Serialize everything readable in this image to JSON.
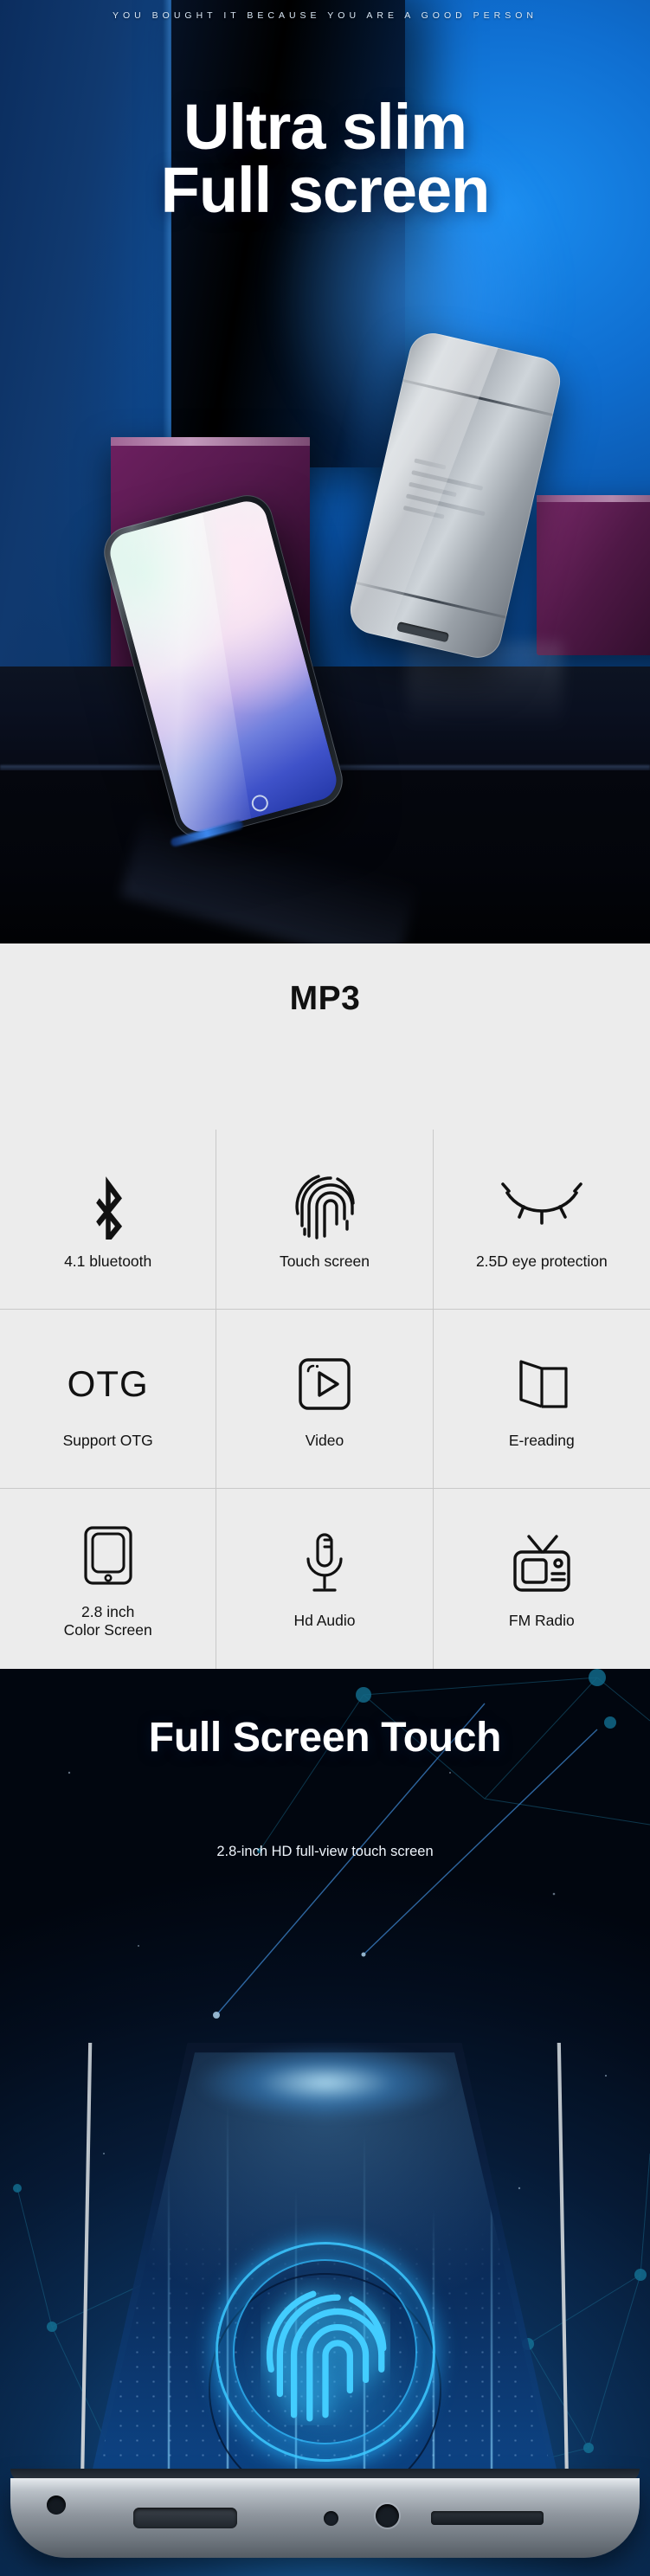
{
  "hero": {
    "tagline": "YOU BOUGHT IT BECAUSE YOU ARE A GOOD PERSON",
    "title_line1": "Ultra slim",
    "title_line2": "Full screen",
    "accent_color": "#0f6ed0",
    "background_color": "#041024"
  },
  "features": {
    "title": "MP3",
    "background_color": "#ececec",
    "divider_color": "#c9c9c9",
    "items": [
      {
        "icon": "bluetooth-icon",
        "label": "4.1 bluetooth"
      },
      {
        "icon": "fingerprint-icon",
        "label": "Touch screen"
      },
      {
        "icon": "closed-eye-icon",
        "label": "2.5D eye protection"
      },
      {
        "icon": "otg-text-icon",
        "icon_text": "OTG",
        "label": "Support OTG"
      },
      {
        "icon": "video-play-icon",
        "label": "Video"
      },
      {
        "icon": "open-book-icon",
        "label": "E-reading"
      },
      {
        "icon": "tablet-screen-icon",
        "label": "2.8 inch\nColor Screen",
        "label_line1": "2.8 inch",
        "label_line2": "Color Screen"
      },
      {
        "icon": "microphone-icon",
        "label": "Hd Audio"
      },
      {
        "icon": "television-icon",
        "label": "FM Radio"
      }
    ]
  },
  "touch": {
    "title": "Full Screen Touch",
    "subtitle": "2.8-inch HD full-view touch screen",
    "glow_color": "#2db9ff",
    "background_color": "#020a16"
  }
}
